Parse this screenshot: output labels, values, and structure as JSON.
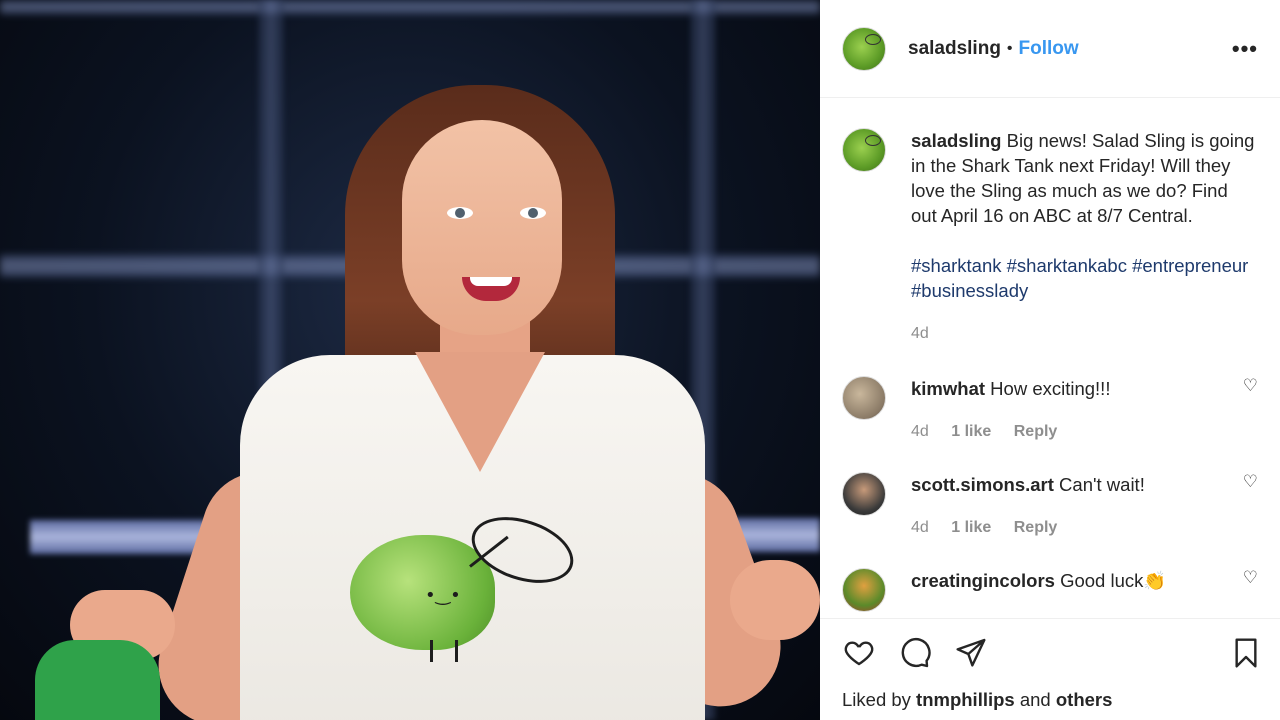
{
  "post": {
    "username": "saladsling",
    "separator": "•",
    "follow_label": "Follow",
    "more_label": "•••",
    "caption_user": "saladsling",
    "caption_text": "Big news! Salad Sling is going in the Shark Tank next Friday! Will they love the Sling as much as we do? Find out April 16 on ABC at 8/7 Central.",
    "hashtags": "#sharktank #sharktankabc #entrepreneur #businesslady",
    "caption_time": "4d"
  },
  "comments": [
    {
      "user": "kimwhat",
      "text": "How exciting!!!",
      "time": "4d",
      "likes": "1 like",
      "reply": "Reply"
    },
    {
      "user": "scott.simons.art",
      "text": "Can't wait!",
      "time": "4d",
      "likes": "1 like",
      "reply": "Reply"
    },
    {
      "user": "creatingincolors",
      "text": "Good luck👏"
    }
  ],
  "footer": {
    "liked_prefix": "Liked by",
    "liked_user": "tnmphillips",
    "liked_and": "and",
    "liked_others": "others"
  },
  "icons": [
    "heart-icon",
    "comment-icon",
    "share-icon",
    "bookmark-icon",
    "more-icon"
  ],
  "colors": {
    "follow": "#3897f0",
    "hashtag": "#1e3a6c",
    "meta": "#8e8e8e"
  }
}
